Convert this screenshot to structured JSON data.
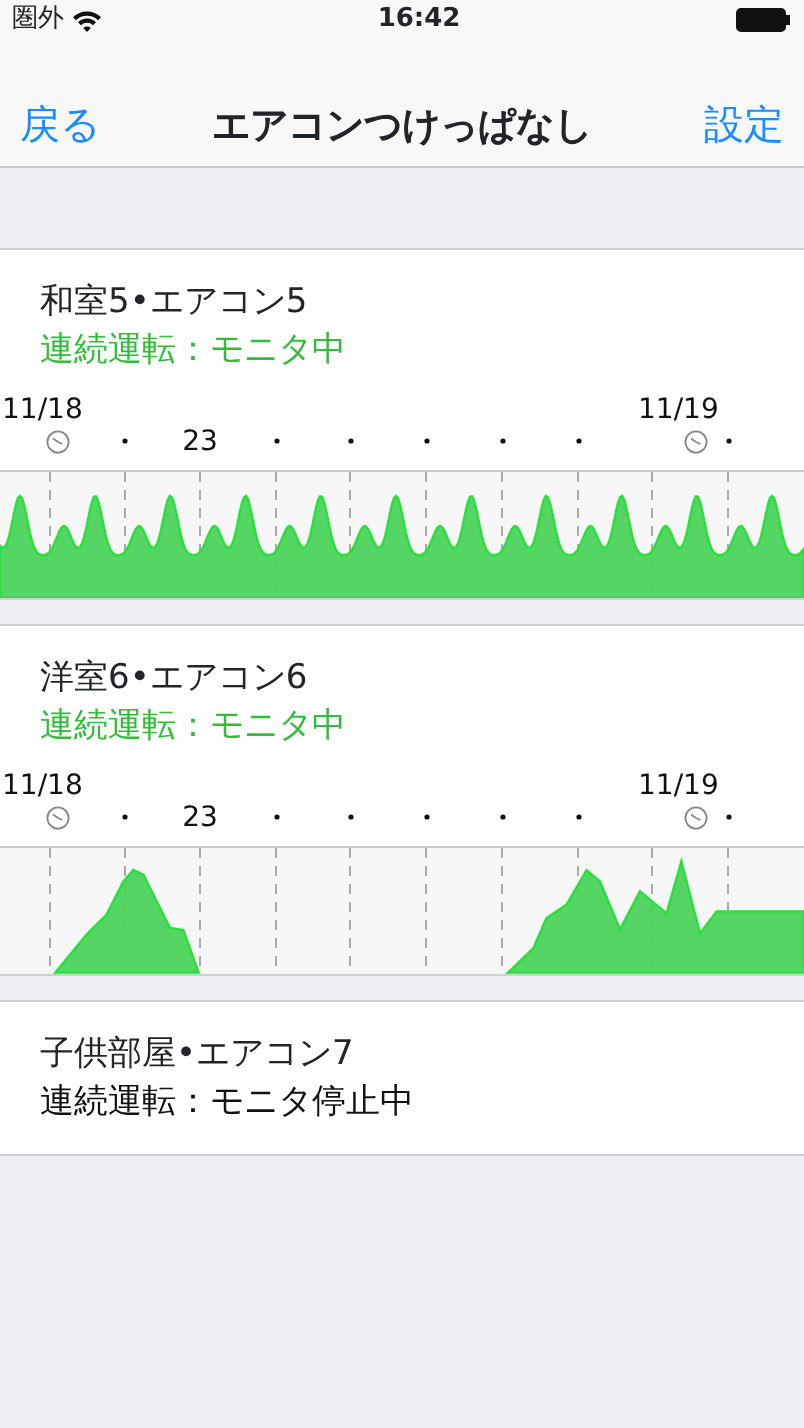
{
  "status_bar": {
    "carrier": "圏外",
    "time": "16:42"
  },
  "nav": {
    "back": "戻る",
    "title": "エアコンつけっぱなし",
    "settings": "設定"
  },
  "devices": [
    {
      "name": "和室5•エアコン5",
      "status": "連続運転：モニタ中",
      "monitoring": true,
      "chart": {
        "kind": "steady",
        "labels": [
          {
            "text": "11/18",
            "kind": "date"
          },
          {
            "text": "23",
            "kind": "hour"
          },
          {
            "text": "11/19",
            "kind": "date"
          }
        ]
      }
    },
    {
      "name": "洋室6•エアコン6",
      "status": "連続運転：モニタ中",
      "monitoring": true,
      "chart": {
        "kind": "bursts",
        "labels": [
          {
            "text": "11/18",
            "kind": "date"
          },
          {
            "text": "23",
            "kind": "hour"
          },
          {
            "text": "11/19",
            "kind": "date"
          }
        ]
      }
    },
    {
      "name": "子供部屋•エアコン7",
      "status": "連続運転：モニタ停止中",
      "monitoring": false
    }
  ]
}
